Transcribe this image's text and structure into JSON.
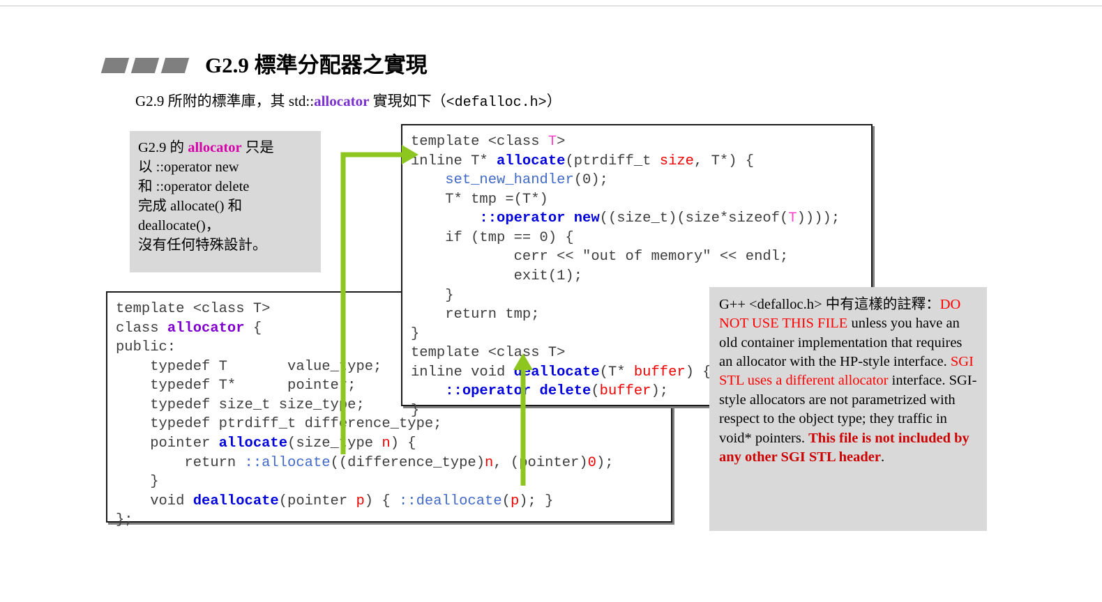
{
  "slide": {
    "bullets_count": 3,
    "title": "G2.9 標準分配器之實現",
    "subtitle_part1": "G2.9 所附的標準庫，其 std::",
    "subtitle_highlight": "allocator",
    "subtitle_part2": " 實現如下（",
    "subtitle_mono": "<defalloc.h>",
    "subtitle_part3": "）"
  },
  "note_left": {
    "line1_a": "G2.9 的 ",
    "line1_hl": "allocator",
    "line1_b": " 只是",
    "line2": "以 ::operator new",
    "line3": "和 ::operator delete",
    "line4": "完成 allocate() 和",
    "line5": "deallocate()，",
    "line6": "沒有任何特殊設計。"
  },
  "note_right": {
    "seg1": "G++ <defalloc.h> 中有這樣的註釋：",
    "seg2_red": "DO NOT USE THIS FILE",
    "seg3": " unless you have an old container implementation that requires an allocator with the HP-style interface. ",
    "seg4_red": "SGI STL uses a different allocator",
    "seg5": " interface.  SGI-style allocators are not parametrized with respect to the object type; they traffic in void* pointers.  ",
    "seg6_redbold": "This file is not included by any other SGI STL header",
    "seg7": "."
  },
  "code_top": {
    "lines": [
      [
        {
          "t": "template <class ",
          "c": "plain"
        },
        {
          "t": "T",
          "c": "ty-pink"
        },
        {
          "t": ">",
          "c": "plain"
        }
      ],
      [
        {
          "t": "inline T* ",
          "c": "plain"
        },
        {
          "t": "allocate",
          "c": "kw-blue"
        },
        {
          "t": "(ptrdiff_t ",
          "c": "plain"
        },
        {
          "t": "size",
          "c": "var-red"
        },
        {
          "t": ", T*) {",
          "c": "plain"
        }
      ],
      [
        {
          "t": "    ",
          "c": "plain"
        },
        {
          "t": "set_new_handler",
          "c": "id-blue"
        },
        {
          "t": "(0);",
          "c": "plain"
        }
      ],
      [
        {
          "t": "    T* tmp =(T*)",
          "c": "plain"
        }
      ],
      [
        {
          "t": "        ",
          "c": "plain"
        },
        {
          "t": "::operator new",
          "c": "kw-blue"
        },
        {
          "t": "((size_t)(size*sizeof(",
          "c": "plain"
        },
        {
          "t": "T",
          "c": "ty-pink"
        },
        {
          "t": "))));",
          "c": "plain"
        }
      ],
      [
        {
          "t": "    if (tmp == 0) {",
          "c": "plain"
        }
      ],
      [
        {
          "t": "            cerr << \"out of memory\" << endl;",
          "c": "plain"
        }
      ],
      [
        {
          "t": "            exit(1);",
          "c": "plain"
        }
      ],
      [
        {
          "t": "    }",
          "c": "plain"
        }
      ],
      [
        {
          "t": "    return tmp;",
          "c": "plain"
        }
      ],
      [
        {
          "t": "}",
          "c": "plain"
        }
      ],
      [
        {
          "t": "template <class T>",
          "c": "plain"
        }
      ],
      [
        {
          "t": "inline void ",
          "c": "plain"
        },
        {
          "t": "deallocate",
          "c": "kw-blue"
        },
        {
          "t": "(T* ",
          "c": "plain"
        },
        {
          "t": "buffer",
          "c": "var-red"
        },
        {
          "t": ") {",
          "c": "plain"
        }
      ],
      [
        {
          "t": "    ",
          "c": "plain"
        },
        {
          "t": "::operator delete",
          "c": "kw-blue"
        },
        {
          "t": "(",
          "c": "plain"
        },
        {
          "t": "buffer",
          "c": "var-red"
        },
        {
          "t": ");",
          "c": "plain"
        }
      ],
      [
        {
          "t": "}",
          "c": "plain"
        }
      ]
    ]
  },
  "code_bottom": {
    "lines": [
      [
        {
          "t": "template <class T>",
          "c": "plain"
        }
      ],
      [
        {
          "t": "class ",
          "c": "plain"
        },
        {
          "t": "allocator",
          "c": "ty-purple"
        },
        {
          "t": " {",
          "c": "plain"
        }
      ],
      [
        {
          "t": "public:",
          "c": "plain"
        }
      ],
      [
        {
          "t": "    typedef T       value_type;",
          "c": "plain"
        }
      ],
      [
        {
          "t": "    typedef T*      pointer;",
          "c": "plain"
        }
      ],
      [
        {
          "t": "    typedef size_t size_type;",
          "c": "plain"
        }
      ],
      [
        {
          "t": "    typedef ptrdiff_t difference_type;",
          "c": "plain"
        }
      ],
      [
        {
          "t": "    pointer ",
          "c": "plain"
        },
        {
          "t": "allocate",
          "c": "kw-blue"
        },
        {
          "t": "(size_type ",
          "c": "plain"
        },
        {
          "t": "n",
          "c": "var-red"
        },
        {
          "t": ") {",
          "c": "plain"
        }
      ],
      [
        {
          "t": "        return ",
          "c": "plain"
        },
        {
          "t": "::allocate",
          "c": "id-blue"
        },
        {
          "t": "((difference_type)",
          "c": "plain"
        },
        {
          "t": "n",
          "c": "var-red"
        },
        {
          "t": ", (pointer)",
          "c": "plain"
        },
        {
          "t": "0",
          "c": "var-red"
        },
        {
          "t": ");",
          "c": "plain"
        }
      ],
      [
        {
          "t": "    }",
          "c": "plain"
        }
      ],
      [
        {
          "t": "    void ",
          "c": "plain"
        },
        {
          "t": "deallocate",
          "c": "kw-blue"
        },
        {
          "t": "(pointer ",
          "c": "plain"
        },
        {
          "t": "p",
          "c": "var-red"
        },
        {
          "t": ") { ",
          "c": "plain"
        },
        {
          "t": "::deallocate",
          "c": "id-blue"
        },
        {
          "t": "(",
          "c": "plain"
        },
        {
          "t": "p",
          "c": "var-red"
        },
        {
          "t": "); }",
          "c": "plain"
        }
      ],
      [
        {
          "t": "};",
          "c": "plain"
        }
      ]
    ]
  },
  "colors": {
    "arrow_green": "#8DC61F",
    "note_bg": "#d9d9d9",
    "bullet_gray": "#7f7f7f",
    "highlight_purple": "#7a2fd0",
    "highlight_magenta": "#d400a8",
    "warn_red": "#ff0000",
    "keyword_blue": "#0000dd"
  }
}
